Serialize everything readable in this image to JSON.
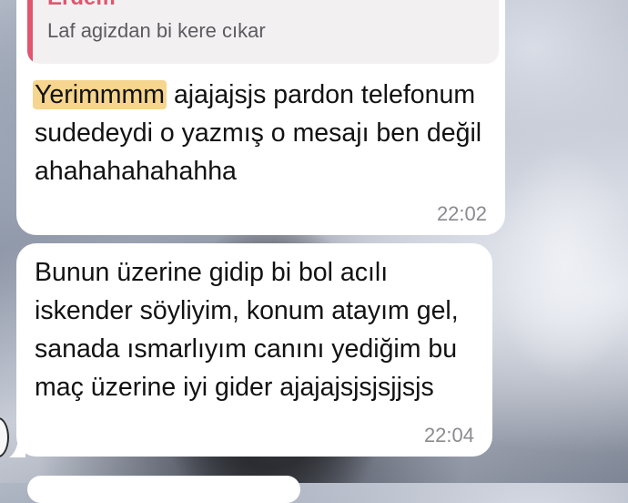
{
  "messages": [
    {
      "quote": {
        "author": "Erdem",
        "text": "Laf agizdan bi kere cıkar"
      },
      "highlight": "Yerimmmm",
      "text": " ajajajsjs pardon telefonum sudedeydi o yazmış o mesajı ben değil ahahahahahahha",
      "time": "22:02"
    },
    {
      "text": "Bunun üzerine gidip bi bol acılı iskender söyliyim, konum atayım gel, sanada ısmarlıyım canını yediğim bu maç üzerine iyi gider ajajajsjsjsjjsjs",
      "time": "22:04"
    }
  ],
  "colors": {
    "bubble": "#ffffff",
    "quote_accent": "#e0566e",
    "highlight": "#f6d58e",
    "timestamp": "#8b8b90"
  }
}
